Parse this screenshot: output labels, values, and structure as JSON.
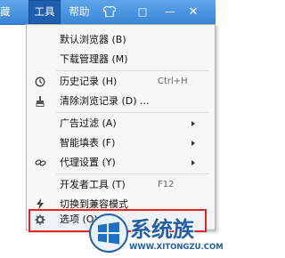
{
  "menubar": {
    "collect_label": "藏",
    "tools_label": "工具",
    "help_label": "帮助",
    "shirt_icon": "shirt-icon",
    "restore_glyph": "□",
    "minimize_glyph": "—",
    "close_glyph": "✕"
  },
  "menu": {
    "items": [
      {
        "label": "默认浏览器 (B)",
        "icon": ""
      },
      {
        "label": "下载管理器 (M)",
        "icon": ""
      },
      {
        "label": "历史记录 (H)",
        "icon": "history-icon",
        "shortcut": "Ctrl+H"
      },
      {
        "label": "清除浏览记录 (D) ...",
        "icon": "clear-icon"
      },
      {
        "label": "广告过滤 (A)",
        "icon": "",
        "submenu": true
      },
      {
        "label": "智能填表 (F)",
        "icon": "",
        "submenu": true
      },
      {
        "label": "代理设置 (Y)",
        "icon": "proxy-icon",
        "submenu": true
      },
      {
        "label": "开发者工具 (T)",
        "icon": "",
        "shortcut": "F12"
      },
      {
        "label": "切换到兼容模式",
        "icon": "lightning-icon"
      },
      {
        "label": "选项 (O)...",
        "icon": "gear-icon"
      }
    ]
  },
  "watermark": {
    "text": "系统族",
    "url": "WWW.XITONGZU.COM"
  },
  "colors": {
    "menubar": "#3a85d6",
    "highlight_border": "#e32626",
    "watermark": "#1f5fa8"
  }
}
